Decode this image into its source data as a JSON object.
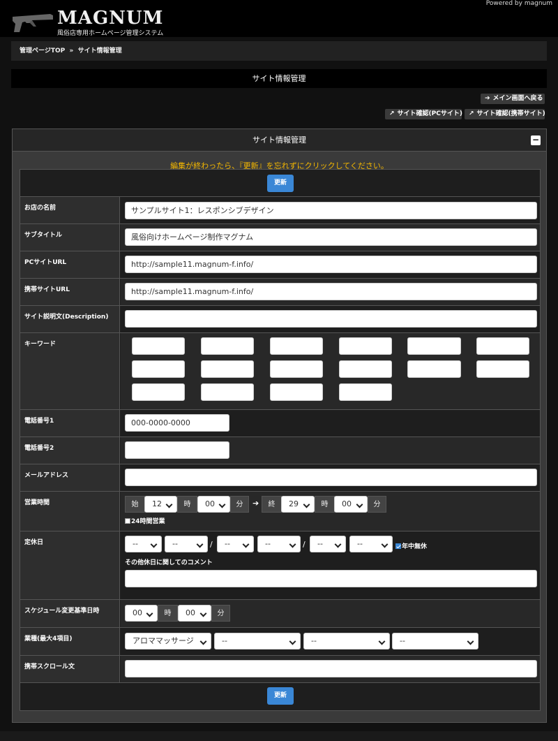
{
  "header": {
    "powered_by": "Powered by magnum",
    "logo_text": "MAGNUM",
    "logo_sub": "風俗店専用ホームページ管理システム"
  },
  "breadcrumb": {
    "home": "管理ページTOP",
    "sep": "»",
    "current": "サイト情報管理"
  },
  "page_title": "サイト情報管理",
  "actions": {
    "back_main": "メイン画面へ戻る",
    "view_pc": "サイト確認(PCサイト)",
    "view_mobile": "サイト確認(携帯サイト)"
  },
  "panel": {
    "title": "サイト情報管理",
    "collapse": "−",
    "notice": "編集が終わったら、『更新』を忘れずにクリックしてください。",
    "update_label": "更新"
  },
  "form": {
    "shop_name": {
      "label": "お店の名前",
      "value": "サンプルサイト1：レスポンシブデザイン"
    },
    "subtitle": {
      "label": "サブタイトル",
      "value": "風俗向けホームページ制作マグナム"
    },
    "pc_url": {
      "label": "PCサイトURL",
      "value": "http://sample11.magnum-f.info/"
    },
    "mobile_url": {
      "label": "携帯サイトURL",
      "value": "http://sample11.magnum-f.info/"
    },
    "description": {
      "label": "サイト説明文(Description)",
      "value": ""
    },
    "keywords": {
      "label": "キーワード",
      "values": [
        "",
        "",
        "",
        "",
        "",
        "",
        "",
        "",
        "",
        "",
        "",
        "",
        "",
        "",
        "",
        ""
      ]
    },
    "phone1": {
      "label": "電話番号1",
      "value": "000-0000-0000"
    },
    "phone2": {
      "label": "電話番号2",
      "value": ""
    },
    "email": {
      "label": "メールアドレス",
      "value": ""
    },
    "hours": {
      "label": "営業時間",
      "start_label": "始",
      "start_hour": "12",
      "hour_unit": "時",
      "start_min": "00",
      "min_unit": "分",
      "arrow": "➔",
      "end_label": "終",
      "end_hour": "29",
      "end_min": "00",
      "all_day_label": "24時間営業",
      "all_day_checked": false
    },
    "holidays": {
      "label": "定休日",
      "selects": [
        "--",
        "--",
        "--",
        "--",
        "--",
        "--"
      ],
      "slash": "/",
      "no_holiday_label": "年中無休",
      "no_holiday_checked": true,
      "comment_label": "その他休日に関してのコメント",
      "comment_value": ""
    },
    "schedule_change": {
      "label": "スケジュール変更基準日時",
      "hour": "00",
      "hour_unit": "時",
      "min": "00",
      "min_unit": "分"
    },
    "business_type": {
      "label": "業種(最大4項目)",
      "values": [
        "アロママッサージ",
        "--",
        "--",
        "--"
      ]
    },
    "mobile_scroll": {
      "label": "携帯スクロール文",
      "value": ""
    }
  }
}
